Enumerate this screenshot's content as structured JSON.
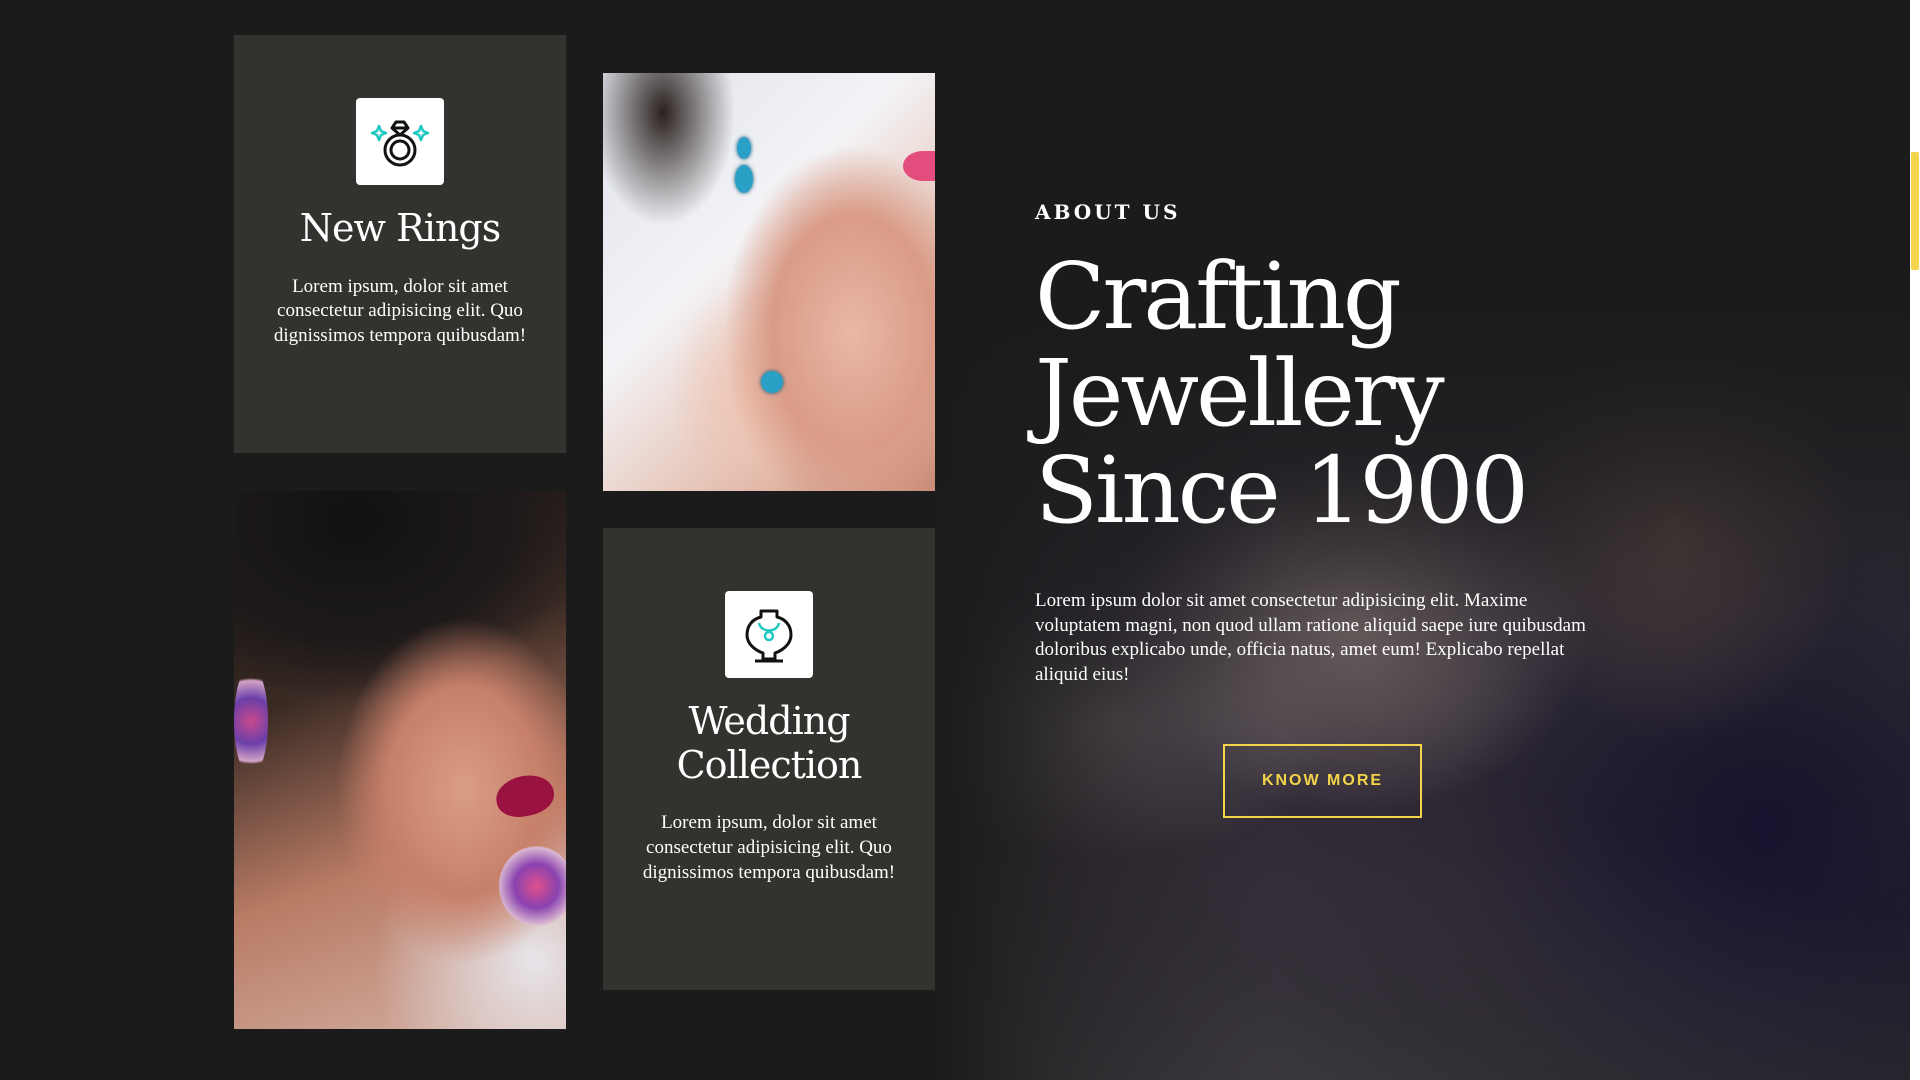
{
  "cards": {
    "rings": {
      "icon": "diamond-ring-icon",
      "title": "New Rings",
      "text": "Lorem ipsum, dolor sit amet consectetur adipisicing elit. Quo dignissimos tempora quibusdam!"
    },
    "wedding": {
      "icon": "necklace-bust-icon",
      "title_line1": "Wedding",
      "title_line2": "Collection",
      "text": "Lorem ipsum, dolor sit amet consectetur adipisicing elit. Quo dignissimos tempora quibusdam!"
    }
  },
  "about": {
    "eyebrow": "ABOUT US",
    "headline": [
      "Crafting",
      "Jewellery",
      "Since 1900"
    ],
    "body": "Lorem ipsum dolor sit amet consectetur adipisicing elit. Maxime voluptatem magni, non quod ullam ratione aliquid saepe iure quibusdam doloribus explicabo unde, officia natus, amet eum! Explicabo repellat aliquid eius!",
    "cta_label": "KNOW MORE"
  },
  "colors": {
    "background": "#1c1b1b",
    "card": "#32322f",
    "accent": "#f3d44a",
    "icon_accent": "#1fc8c0"
  }
}
